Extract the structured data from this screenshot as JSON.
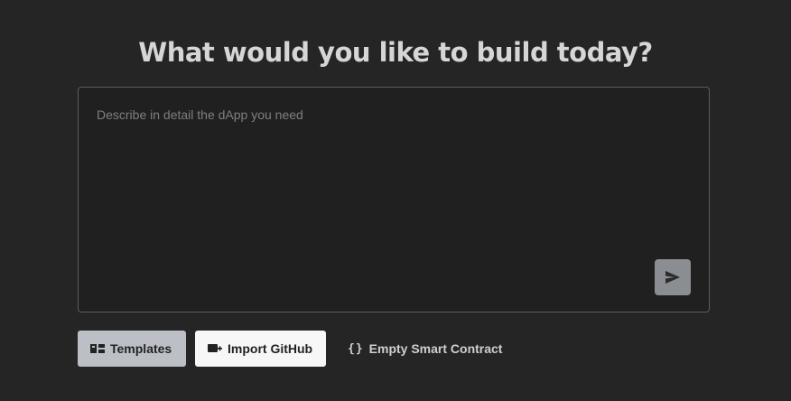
{
  "heading": "What would you like to build today?",
  "prompt": {
    "placeholder": "Describe in detail the dApp you need",
    "value": ""
  },
  "send": {
    "icon": "send-icon"
  },
  "actions": {
    "templates_label": "Templates",
    "templates_icon": "templates-icon",
    "import_github_label": "Import GitHub",
    "import_github_icon": "import-github-icon",
    "empty_contract_label": "Empty Smart Contract",
    "empty_contract_icon": "braces-icon"
  },
  "colors": {
    "background": "#252525",
    "input_background": "#202020",
    "input_border": "#5c5c5c",
    "send_button": "#8a8d91",
    "templates_button": "#bcc0c6",
    "github_button": "#f7f7f7"
  }
}
